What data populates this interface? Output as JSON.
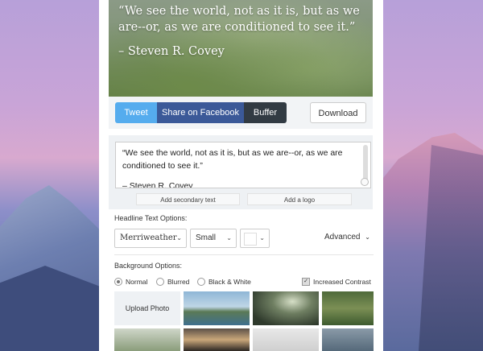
{
  "hero": {
    "quote": "“We see the world, not as it is, but as we are--or, as we are conditioned to see it.”",
    "author": "– Steven R. Covey"
  },
  "share": {
    "tweet": "Tweet",
    "facebook": "Share on Facebook",
    "buffer": "Buffer",
    "download": "Download"
  },
  "editor": {
    "text_line1": "“We see the world, not as it is, but as we are--or, as we are",
    "text_line2": "conditioned to see it.”",
    "text_line3": "– Steven R. Covey",
    "add_secondary": "Add secondary text",
    "add_logo": "Add a logo"
  },
  "headline": {
    "label": "Headline Text Options:",
    "font": "Merriweather",
    "size": "Small",
    "advanced": "Advanced"
  },
  "background": {
    "label": "Background Options:",
    "options": [
      "Normal",
      "Blurred",
      "Black & White"
    ],
    "selected": "Normal",
    "increased_contrast": "Increased Contrast",
    "upload": "Upload Photo"
  },
  "colors": {
    "tweet": "#55acee",
    "facebook": "#3b5998",
    "buffer": "#323b43"
  }
}
